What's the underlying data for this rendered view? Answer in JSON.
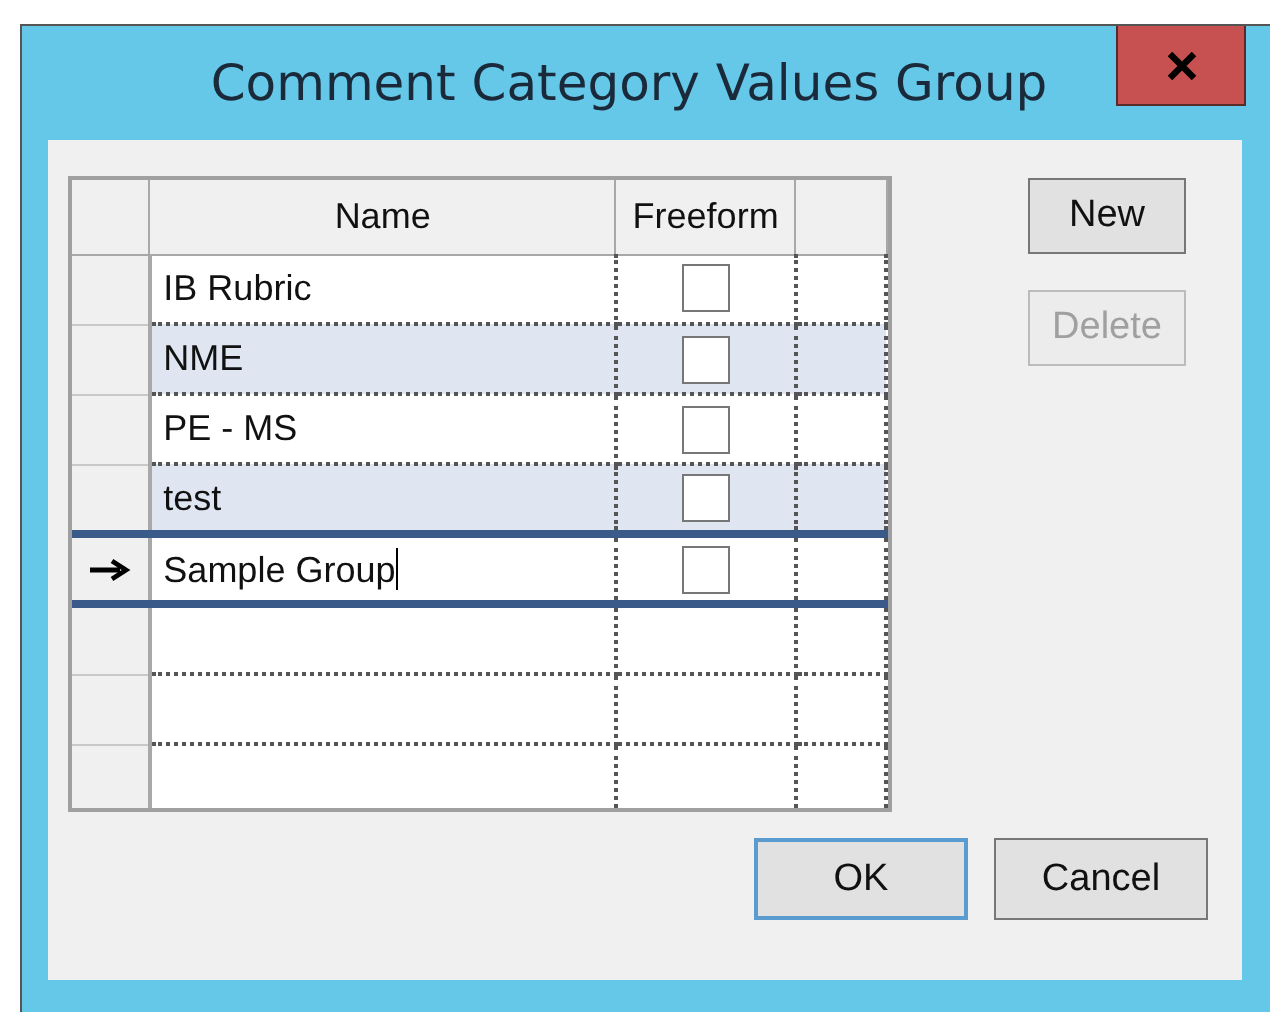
{
  "window": {
    "title": "Comment Category Values Group"
  },
  "table": {
    "columns": [
      "Name",
      "Freeform"
    ],
    "rows": [
      {
        "name": "IB Rubric",
        "freeform": false,
        "current": false,
        "editing": false
      },
      {
        "name": "NME",
        "freeform": false,
        "current": false,
        "editing": false
      },
      {
        "name": "PE - MS",
        "freeform": false,
        "current": false,
        "editing": false
      },
      {
        "name": "test",
        "freeform": false,
        "current": false,
        "editing": false
      },
      {
        "name": "Sample Group",
        "freeform": false,
        "current": true,
        "editing": true
      }
    ]
  },
  "side_buttons": [
    {
      "label": "New",
      "disabled": false
    },
    {
      "label": "Delete",
      "disabled": true
    }
  ],
  "buttons": [
    {
      "label": "OK",
      "default": true
    },
    {
      "label": "Cancel",
      "default": false
    }
  ]
}
